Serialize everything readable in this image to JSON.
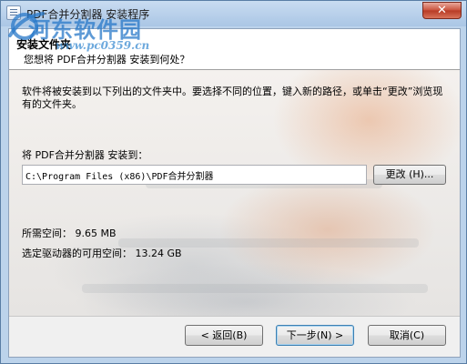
{
  "window": {
    "title": "PDF合并分割器 安装程序",
    "close_label": "✕"
  },
  "watermark": {
    "site_name": "河东软件园",
    "url": "www.pc0359.cn"
  },
  "header": {
    "title": "安装文件夹",
    "subtitle": "您想将 PDF合并分割器 安装到何处？"
  },
  "content": {
    "description": "软件将被安装到以下列出的文件夹中。要选择不同的位置，键入新的路径，或单击“更改”浏览现有的文件夹。",
    "install_label": "将 PDF合并分割器 安装到：",
    "install_path": "C:\\Program Files (x86)\\PDF合并分割器",
    "change_button": "更改 (H)...",
    "space_required": "所需空间： 9.65 MB",
    "space_available": "选定驱动器的可用空间： 13.24 GB"
  },
  "footer": {
    "back_button": "< 返回(B)",
    "next_button": "下一步(N) >",
    "cancel_button": "取消(C)"
  },
  "icons": {
    "app": "installer-icon",
    "close": "close-icon",
    "watermark": "watermark-logo-icon"
  },
  "colors": {
    "title_bar": "#aac6e5",
    "close_button": "#c8503a",
    "default_button_border": "#3c7fb1"
  }
}
